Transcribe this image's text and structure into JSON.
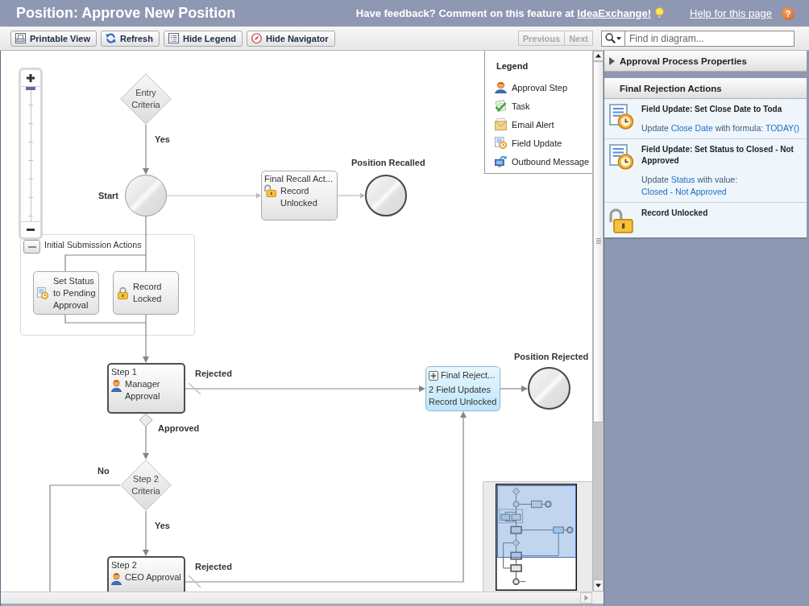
{
  "header": {
    "title": "Position: Approve New Position",
    "feedback": "Have feedback? Comment on this feature at",
    "feedback_link": "IdeaExchange!",
    "help_link": "Help for this page",
    "help_icon": "?"
  },
  "toolbar": {
    "buttons": [
      {
        "kind": "print",
        "label": "Printable View"
      },
      {
        "kind": "refresh",
        "label": "Refresh"
      },
      {
        "kind": "legend",
        "label": "Hide Legend"
      },
      {
        "kind": "navigator",
        "label": "Hide Navigator"
      }
    ],
    "pager": [
      {
        "label": "Previous",
        "disabled": true
      },
      {
        "label": "Next",
        "disabled": true
      }
    ],
    "search": {
      "placeholder": "Find in diagram..."
    }
  },
  "diagram": {
    "zoom": {
      "level": 1
    },
    "entry_criteria": {
      "text": "Entry Criteria",
      "yes_label": "Yes"
    },
    "start": {
      "label": "Start"
    },
    "recall_actions": {
      "title": "Final Recall Act...",
      "items": [
        "Record Unlocked"
      ],
      "selected": false
    },
    "recalled_end": {
      "label": "Position Recalled"
    },
    "initial_submission": {
      "title": "Initial Submission Actions",
      "expanded": true,
      "actions": [
        {
          "kind": "field",
          "text": "Set Status to Pending Approval"
        },
        {
          "kind": "lock",
          "text": "Record Locked"
        }
      ]
    },
    "steps": [
      {
        "title": "Step 1",
        "name": "Manager Approval",
        "rejected_label": "Rejected",
        "selected": false
      },
      {
        "title": "Step 2",
        "name": "CEO Approval",
        "rejected_label": "Rejected",
        "selected": false
      }
    ],
    "approved_label": "Approved",
    "step2_criteria": {
      "text": "Step 2 Criteria",
      "no_label": "No",
      "yes_label": "Yes"
    },
    "rejection_actions": {
      "title": "Final Reject...",
      "items": [
        "2 Field Updates",
        "Record Unlocked"
      ],
      "expanded": false,
      "selected": true
    },
    "rejected_end": {
      "label": "Position Rejected"
    }
  },
  "legend": {
    "title": "Legend",
    "items": [
      {
        "kind": "step",
        "label": "Approval Step"
      },
      {
        "kind": "task",
        "label": "Task"
      },
      {
        "kind": "email",
        "label": "Email Alert"
      },
      {
        "kind": "field",
        "label": "Field Update"
      },
      {
        "kind": "outbound",
        "label": "Outbound Message"
      }
    ]
  },
  "properties": {
    "title": "Approval Process Properties",
    "expanded": false
  },
  "actions_panel": {
    "title": "Final Rejection Actions",
    "items": [
      {
        "kind": "field",
        "title": "Field Update: Set Close Date to Toda",
        "description": [
          {
            "kind": "text",
            "text": "Update"
          },
          {
            "kind": "field",
            "text": "Close Date"
          },
          {
            "kind": "text",
            "text": "with formula:"
          },
          {
            "kind": "value",
            "text": "TODAY()"
          }
        ]
      },
      {
        "kind": "field",
        "title": "Field Update: Set Status to Closed - Not Approved",
        "description": [
          {
            "kind": "text",
            "text": "Update"
          },
          {
            "kind": "field",
            "text": "Status"
          },
          {
            "kind": "text",
            "text": "with value:"
          },
          {
            "kind": "value",
            "text": "Closed - Not Approved"
          }
        ]
      },
      {
        "kind": "unlock",
        "title": "Record Unlocked"
      }
    ]
  }
}
